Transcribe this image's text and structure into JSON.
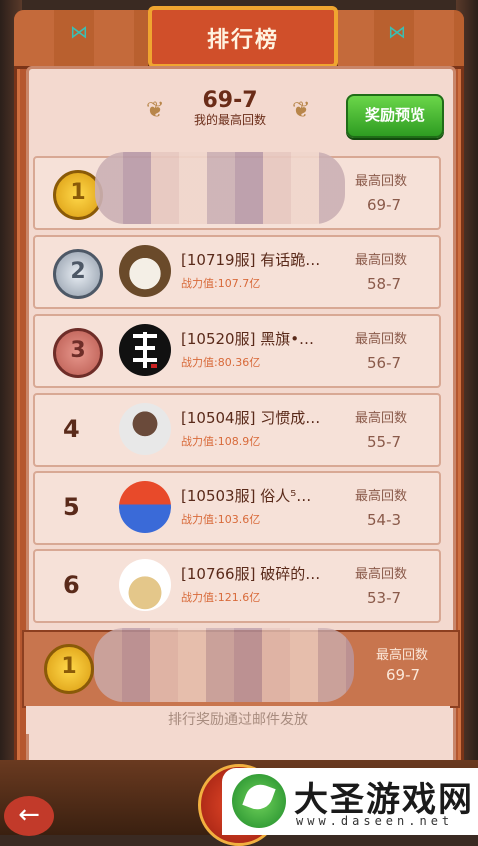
{
  "header": {
    "title": "排行榜"
  },
  "best": {
    "value": "69-7",
    "label": "我的最高回数"
  },
  "reward_button": "奖励预览",
  "rows": [
    {
      "rank": "1",
      "name": "",
      "power": "",
      "hl_label": "最高回数",
      "hl_value": "69-7",
      "medal": "gold"
    },
    {
      "rank": "2",
      "name": "[10719服] 有话跪…",
      "power": "战力值:107.7亿",
      "hl_label": "最高回数",
      "hl_value": "58-7",
      "medal": "silver"
    },
    {
      "rank": "3",
      "name": "[10520服] 黑旗•…",
      "power": "战力值:80.36亿",
      "hl_label": "最高回数",
      "hl_value": "56-7",
      "medal": "bronze"
    },
    {
      "rank": "4",
      "name": "[10504服] 习惯成…",
      "power": "战力值:108.9亿",
      "hl_label": "最高回数",
      "hl_value": "55-7",
      "medal": "none"
    },
    {
      "rank": "5",
      "name": "[10503服] 俗人⁵…",
      "power": "战力值:103.6亿",
      "hl_label": "最高回数",
      "hl_value": "54-3",
      "medal": "none"
    },
    {
      "rank": "6",
      "name": "[10766服] 破碎的…",
      "power": "战力值:121.6亿",
      "hl_label": "最高回数",
      "hl_value": "53-7",
      "medal": "none"
    }
  ],
  "my_row": {
    "rank": "1",
    "hl_label": "最高回数",
    "hl_value": "69-7"
  },
  "footer": "排行奖励通过邮件发放",
  "watermark": {
    "title": "大圣游戏网",
    "url": "www.daseen.net"
  }
}
